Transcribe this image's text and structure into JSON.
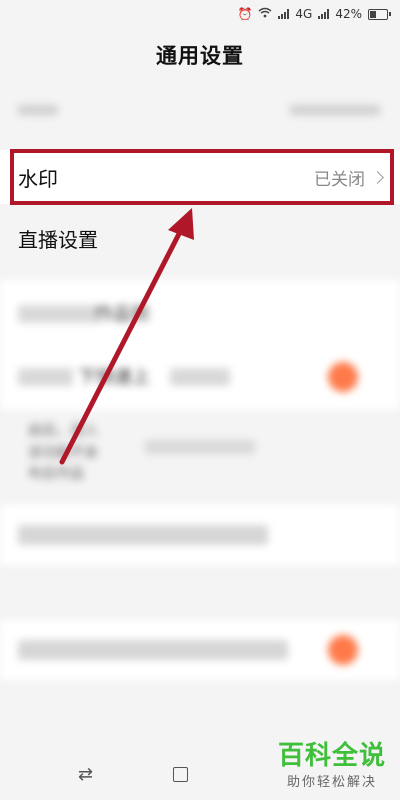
{
  "status_bar": {
    "alarm_icon": "alarm-icon",
    "wifi_icon": "wifi-icon",
    "network": "4G",
    "battery": "42%",
    "battery_level": 0.42
  },
  "header": {
    "title": "通用设置"
  },
  "settings": {
    "watermark": {
      "label": "水印",
      "value": "已关闭"
    },
    "live": {
      "label": "直播设置"
    }
  },
  "blurred": {
    "row3_fragment": "作品到",
    "row4_fragment": "下快速上",
    "desc_line1": "启后，进入",
    "desc_line2": "该功能不会",
    "desc_line3": "布后作品"
  },
  "nav": {
    "back_icon": "swap-arrows-icon",
    "recent_icon": "square-icon"
  },
  "watermark_logo": {
    "main": "百科全说",
    "sub": "助你轻松解决"
  },
  "colors": {
    "highlight": "#b0182a",
    "accent_orange": "#ff7a4a",
    "brand_green": "#3fbf3a"
  }
}
